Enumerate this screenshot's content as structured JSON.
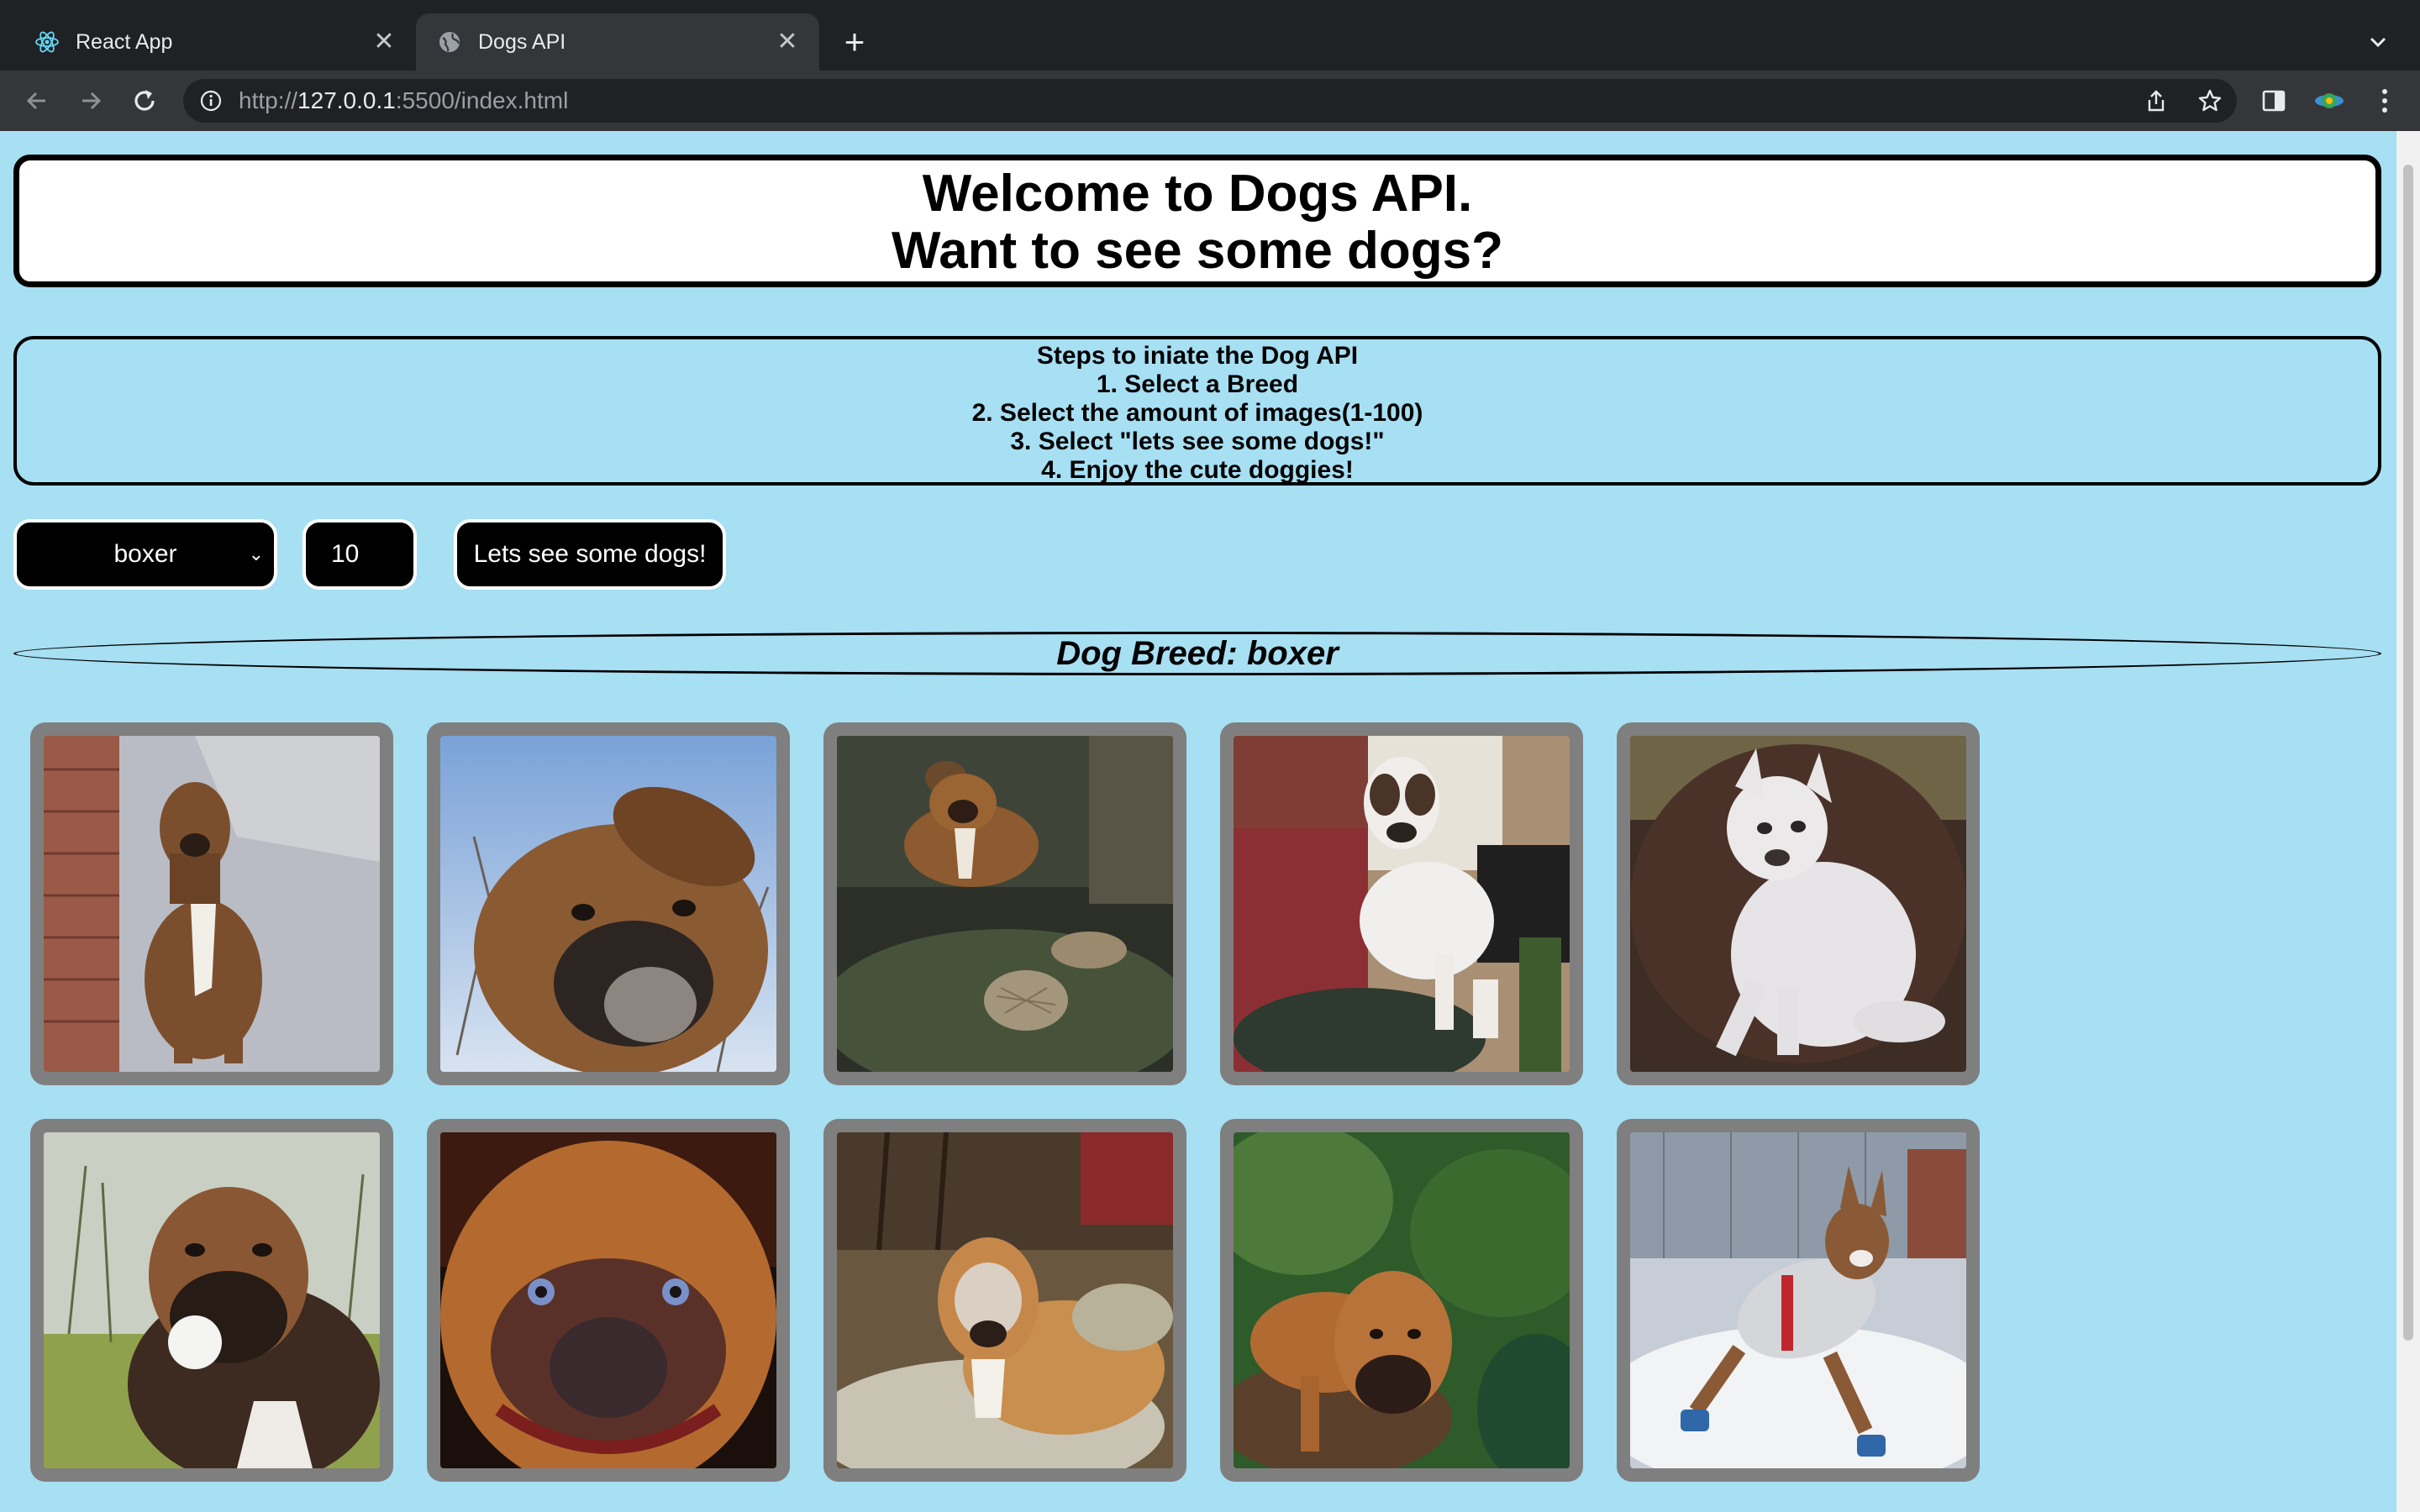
{
  "browser": {
    "tabs": [
      {
        "title": "React App",
        "active": false
      },
      {
        "title": "Dogs API",
        "active": true
      }
    ],
    "address": {
      "prefix": "http://",
      "host": "127.0.0.1",
      "rest": ":5500/index.html"
    }
  },
  "page": {
    "welcome": {
      "line1": "Welcome to Dogs API.",
      "line2": "Want to see some dogs?"
    },
    "steps": [
      "Steps to iniate the Dog API",
      "1. Select a Breed",
      "2. Select the amount of images(1-100)",
      "3. Select \"lets see some dogs!\"",
      "4. Enjoy the cute doggies!"
    ],
    "controls": {
      "breed_selected": "boxer",
      "image_count": "10",
      "submit_label": "Lets see some dogs!"
    },
    "breed_heading": "Dog Breed: boxer",
    "dog_images": [
      {
        "name": "boxer sitting by brick wall"
      },
      {
        "name": "boxer face close-up sky"
      },
      {
        "name": "boxer in garden with hedgehog"
      },
      {
        "name": "white boxer on red couch"
      },
      {
        "name": "white boxer on brown armchair"
      },
      {
        "name": "boxer with ball in grass"
      },
      {
        "name": "boxer face close-up"
      },
      {
        "name": "old boxer lying on rug"
      },
      {
        "name": "boxer among bushes"
      },
      {
        "name": "boxer running in snow"
      }
    ]
  }
}
